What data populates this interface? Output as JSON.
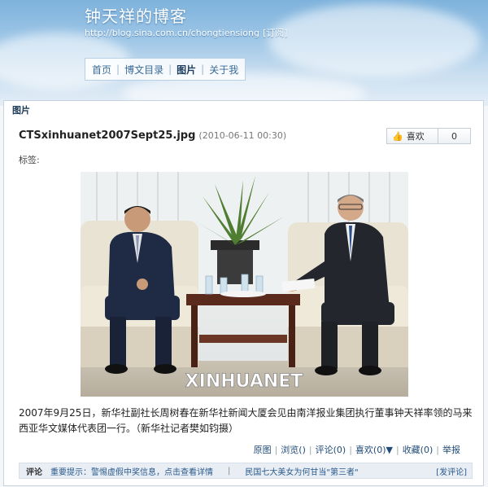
{
  "header": {
    "blog_title": "钟天祥的博客",
    "blog_url": "http://blog.sina.com.cn/chongtiensiong",
    "subscribe_label": "[订阅]"
  },
  "nav": {
    "items": [
      {
        "label": "首页"
      },
      {
        "label": "博文目录"
      },
      {
        "label": "图片",
        "active": true
      },
      {
        "label": "关于我"
      }
    ]
  },
  "panel": {
    "heading": "图片"
  },
  "post": {
    "filename": "CTSxinhuanet2007Sept25.jpg",
    "date": "(2010-06-11 00:30)",
    "tags_label": "标签:",
    "like_label": "喜欢",
    "like_count": "0",
    "watermark": "XINHUANET",
    "caption": "2007年9月25日，新华社副社长周树春在新华社新闻大厦会见由南洋报业集团执行董事钟天祥率领的马来西亚华文媒体代表团一行。（新华社记者樊如钧摄）"
  },
  "actions": {
    "original": "原图",
    "views": "浏览()",
    "comments": "评论(0)",
    "likes": "喜欢(0)▼",
    "favorites": "收藏(0)",
    "report": "举报"
  },
  "footer": {
    "label": "评论",
    "tip": "重要提示：警惕虚假中奖信息，点击查看详情",
    "promo": "民国七大美女为何甘当\"第三者\"",
    "post_comment": "[发评论]"
  },
  "colors": {
    "header_sky": "#8fbde3",
    "nav_text": "#3b6b99",
    "link": "#224c77"
  }
}
